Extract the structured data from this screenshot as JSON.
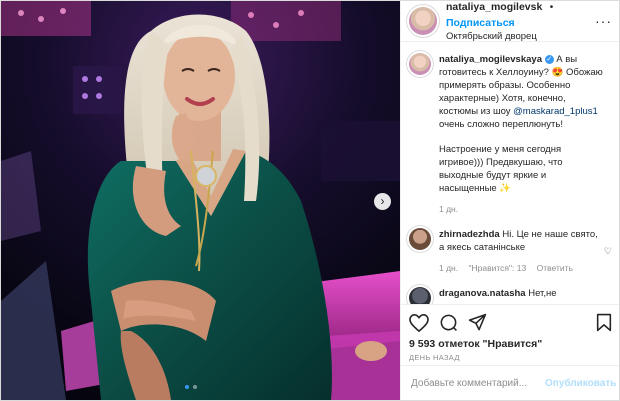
{
  "header": {
    "username": "nataliya_mogilevsk",
    "separator": "•",
    "follow_label": "Подписаться",
    "location": "Октябрьский дворец",
    "more_icon": "more-horizontal-icon"
  },
  "caption": {
    "username": "nataliya_mogilevskaya",
    "text_1": " А вы готовитесь к Хеллоуину? 😍 Обожаю примерять образы. Особенно характерные) Хотя, конечно, костюмы из шоу ",
    "mention": "@maskarad_1plus1",
    "text_2": " очень сложно переплюнуть!",
    "text_3": "Настроение у меня сегодня игривое))) Предвкушаю, что выходные будут яркие и насыщенные ✨",
    "time": "1 дн."
  },
  "comments": [
    {
      "username": "zhirnadezhda",
      "text": " Hi. Це не наше свято, а якесь сатанінське",
      "time": "1 дн.",
      "likes": "\"Нравится\": 13",
      "reply": "Ответить"
    },
    {
      "username": "draganova.natasha",
      "text": " Нет,не"
    }
  ],
  "actions": {
    "like_icon": "heart-icon",
    "comment_icon": "comment-icon",
    "share_icon": "share-icon",
    "save_icon": "bookmark-icon"
  },
  "likes_text": "9 593 отметок \"Нравится\"",
  "date_text": "ДЕНЬ НАЗАД",
  "add_comment": {
    "placeholder": "Добавьте комментарий...",
    "publish_label": "Опубликовать"
  },
  "carousel": {
    "next_icon": "chevron-right-icon",
    "count": 2,
    "active_index": 0
  },
  "colors": {
    "link": "#0095f6",
    "mention": "#00376b",
    "muted": "#8e8e8e",
    "publish_disabled": "#b2dffc",
    "dress": "#0e5a4f"
  }
}
